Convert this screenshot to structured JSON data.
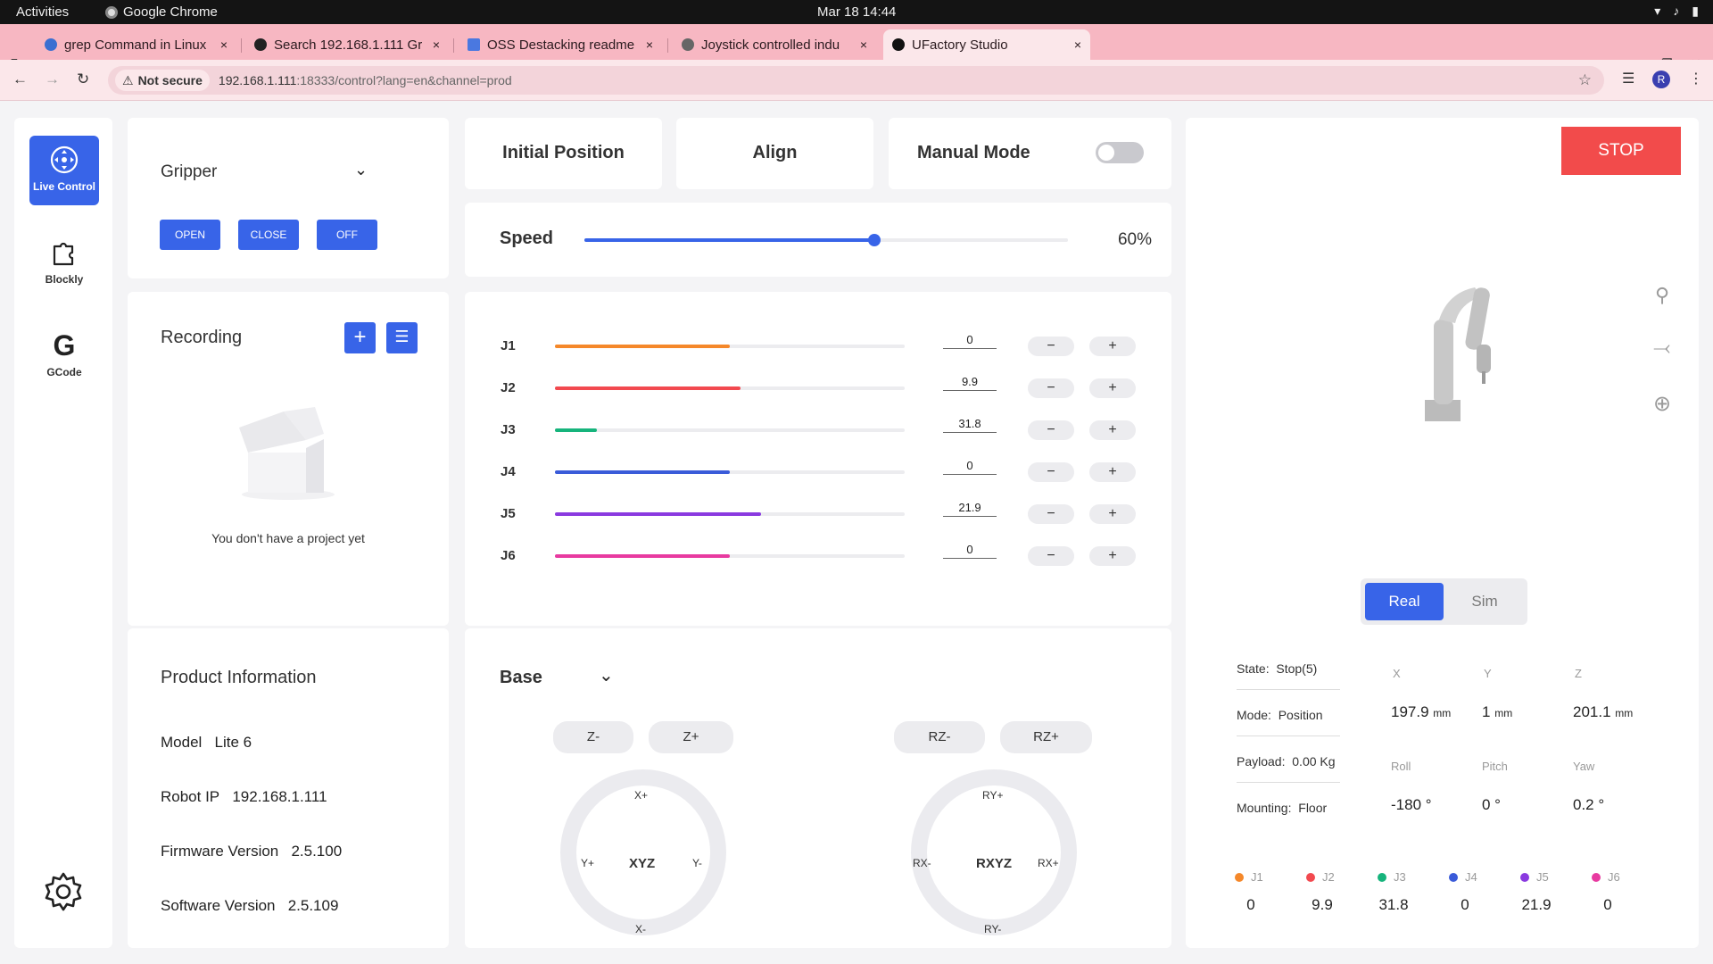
{
  "system": {
    "activities": "Activities",
    "app_name": "Google Chrome",
    "clock": "Mar 18  14:44"
  },
  "browser": {
    "tabs": [
      {
        "title": "grep Command in Linux",
        "close": "×"
      },
      {
        "title": "Search 192.168.1.111 Gr",
        "close": "×"
      },
      {
        "title": "OSS Destacking readme",
        "close": "×"
      },
      {
        "title": "Joystick controlled indu",
        "close": "×"
      },
      {
        "title": "UFactory Studio",
        "close": "×"
      }
    ],
    "not_secure": "Not secure",
    "url_host": "192.168.1.111",
    "url_rest": ":18333/control?lang=en&channel=prod",
    "profile_initial": "R"
  },
  "sidebar": {
    "items": [
      {
        "label": "Live Control",
        "icon": "joystick-icon"
      },
      {
        "label": "Blockly",
        "icon": "puzzle-icon"
      },
      {
        "label": "GCode",
        "icon": "gcode-icon"
      }
    ],
    "accent": "#3864e8"
  },
  "gripper": {
    "title": "Gripper",
    "open": "OPEN",
    "close": "CLOSE",
    "off": "OFF"
  },
  "recording": {
    "title": "Recording",
    "empty_text": "You don't have a project yet"
  },
  "product": {
    "title": "Product Information",
    "model_label": "Model",
    "model_value": "Lite 6",
    "ip_label": "Robot IP",
    "ip_value": "192.168.1.111",
    "fw_label": "Firmware Version",
    "fw_value": "2.5.100",
    "sw_label": "Software Version",
    "sw_value": "2.5.109"
  },
  "controls": {
    "initial_position": "Initial Position",
    "align": "Align",
    "manual_mode": "Manual Mode",
    "manual_mode_on": false,
    "speed_label": "Speed",
    "speed_value": "60%",
    "speed_fraction": 0.6
  },
  "joints": [
    {
      "label": "J1",
      "value": "0",
      "color": "#f5882a",
      "fraction": 0.5
    },
    {
      "label": "J2",
      "value": "9.9",
      "color": "#f2494f",
      "fraction": 0.53
    },
    {
      "label": "J3",
      "value": "31.8",
      "color": "#16b47c",
      "fraction": 0.12
    },
    {
      "label": "J4",
      "value": "0",
      "color": "#3a5bd9",
      "fraction": 0.5
    },
    {
      "label": "J5",
      "value": "21.9",
      "color": "#8a3ae0",
      "fraction": 0.59
    },
    {
      "label": "J6",
      "value": "0",
      "color": "#e83aa0",
      "fraction": 0.5
    }
  ],
  "stepper": {
    "minus": "−",
    "plus": "+"
  },
  "base": {
    "title": "Base",
    "z_minus": "Z-",
    "z_plus": "Z+",
    "rz_minus": "RZ-",
    "rz_plus": "RZ+",
    "xyz": {
      "center": "XYZ",
      "top": "X+",
      "bottom": "X-",
      "left": "Y+",
      "right": "Y-"
    },
    "rxyz": {
      "center": "RXYZ",
      "top": "RY+",
      "bottom": "RY-",
      "left": "RX-",
      "right": "RX+"
    }
  },
  "status": {
    "stop": "STOP",
    "real": "Real",
    "sim": "Sim",
    "state_label": "State:",
    "state_value": "Stop(5)",
    "mode_label": "Mode:",
    "mode_value": "Position",
    "payload_label": "Payload:",
    "payload_value": "0.00 Kg",
    "mounting_label": "Mounting:",
    "mounting_value": "Floor",
    "x_label": "X",
    "x_value": "197.9",
    "x_unit": "mm",
    "y_label": "Y",
    "y_value": "1",
    "y_unit": "mm",
    "z_label": "Z",
    "z_value": "201.1",
    "z_unit": "mm",
    "roll_label": "Roll",
    "roll_value": "-180 °",
    "pitch_label": "Pitch",
    "pitch_value": "0 °",
    "yaw_label": "Yaw",
    "yaw_value": "0.2 °",
    "stop_color": "#f24b4b"
  }
}
